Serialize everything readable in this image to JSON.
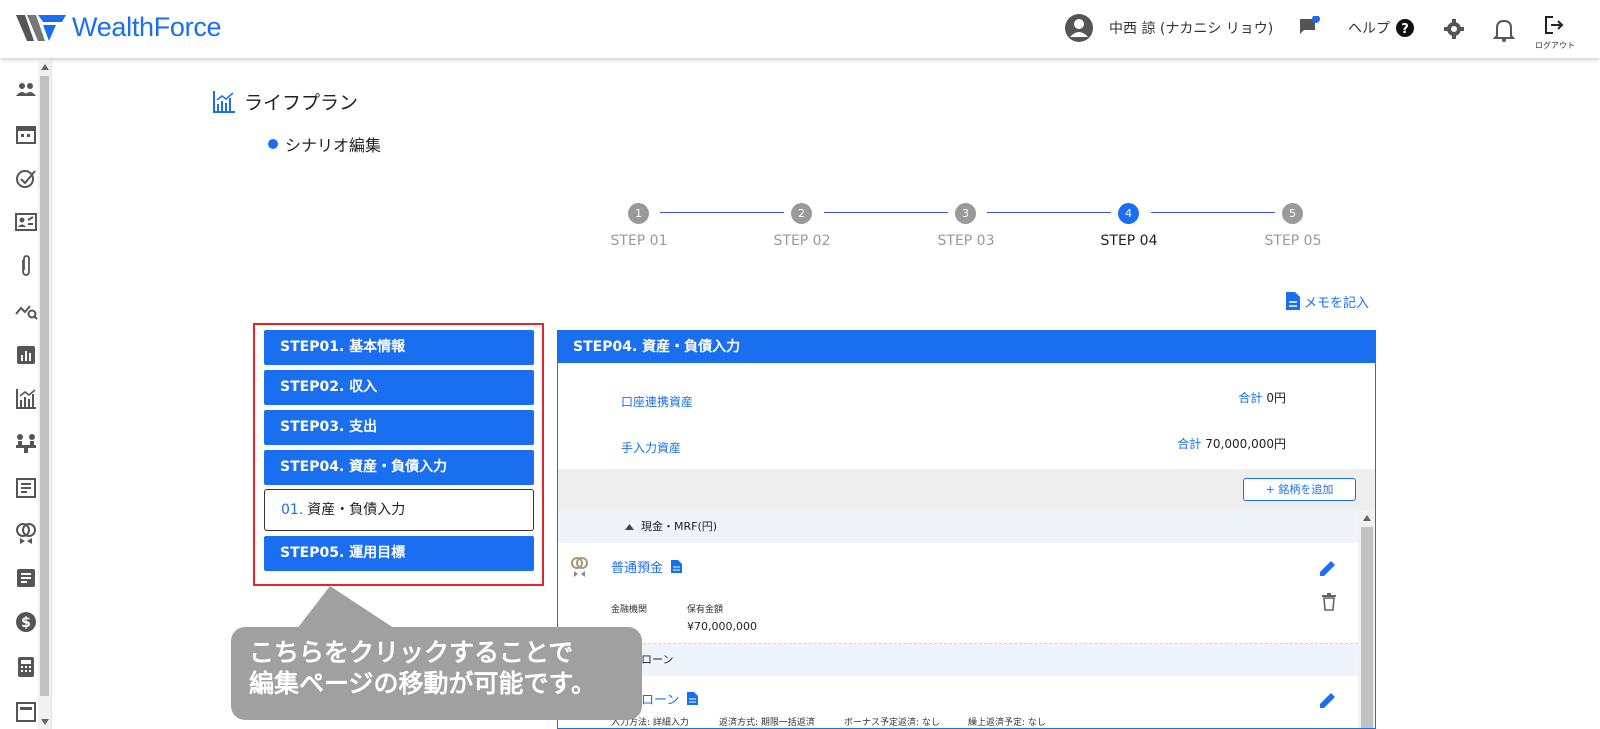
{
  "header": {
    "logo_text": "WealthForce",
    "user_name": "中西 諒 (ナカニシ リョウ)",
    "help_label": "ヘルプ",
    "logout_label": "ログアウト",
    "icons": [
      "user-avatar-icon",
      "chat-icon",
      "help-icon",
      "gear-icon",
      "bell-icon",
      "logout-icon"
    ]
  },
  "sidebar": {
    "icons": [
      "people-icon",
      "calendar-icon",
      "check-circle-icon",
      "id-card-icon",
      "paperclip-icon",
      "chart-search-icon",
      "bar-chart-icon",
      "lifeplan-icon",
      "meeting-icon",
      "article-icon",
      "rings-icon",
      "notes-icon",
      "dollar-icon",
      "calculator-icon",
      "document-icon"
    ]
  },
  "page": {
    "title": "ライフプラン",
    "section": "シナリオ編集",
    "memo_label": "メモを記入"
  },
  "stepper": {
    "steps": [
      {
        "num": "1",
        "label": "STEP 01"
      },
      {
        "num": "2",
        "label": "STEP 02"
      },
      {
        "num": "3",
        "label": "STEP 03"
      },
      {
        "num": "4",
        "label": "STEP 04"
      },
      {
        "num": "5",
        "label": "STEP 05"
      }
    ],
    "active_step": 4
  },
  "step_nav": {
    "items": [
      "STEP01. 基本情報",
      "STEP02. 収入",
      "STEP03. 支出",
      "STEP04. 資産・負債入力",
      "STEP05. 運用目標"
    ],
    "sub_item": {
      "num": "01.",
      "label": "資産・負債入力"
    }
  },
  "panel": {
    "title": "STEP04. 資産・負債入力",
    "linked_assets": {
      "label": "口座連携資産",
      "total_key": "合計",
      "total_value": "0円"
    },
    "manual_assets": {
      "label": "手入力資産",
      "total_key": "合計",
      "total_value": "70,000,000円"
    },
    "add_button": "+ 銘柄を追加",
    "category1": "現金・MRF(円)",
    "item1": {
      "name": "普通預金",
      "field1_label": "金融機関",
      "field2_label": "保有金額",
      "amount": "¥70,000,000"
    },
    "category2": "ローン",
    "item2": {
      "name": "ローン",
      "details": [
        "入力方法: 詳細入力",
        "返済方式: 期限一括返済",
        "ボーナス予定返済: なし",
        "繰上返済予定: なし"
      ]
    }
  },
  "callout": {
    "line1": "こちらをクリックすることで",
    "line2": "編集ページの移動が可能です。"
  },
  "colors": {
    "accent": "#1a6ff0",
    "highlight_border": "#e8232a",
    "callout_bg": "#a0a0a0",
    "step_inactive": "#9a9a9a"
  }
}
